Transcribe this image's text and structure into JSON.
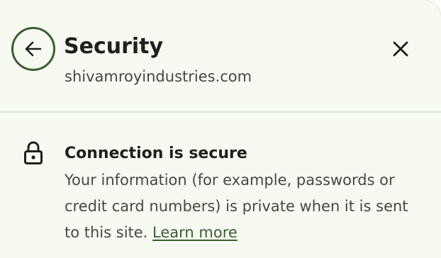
{
  "header": {
    "title": "Security",
    "site": "shivamroyindustries.com",
    "back_icon": "arrow-left-icon",
    "close_icon": "close-icon"
  },
  "connection": {
    "icon": "lock-icon",
    "title": "Connection is secure",
    "description": "Your information (for example, passwords or credit card numbers) is private when it is sent to this site.",
    "learn_more": "Learn more"
  },
  "colors": {
    "background": "#f6faf1",
    "accent": "#3c5d32",
    "divider": "#cfe8c4"
  }
}
